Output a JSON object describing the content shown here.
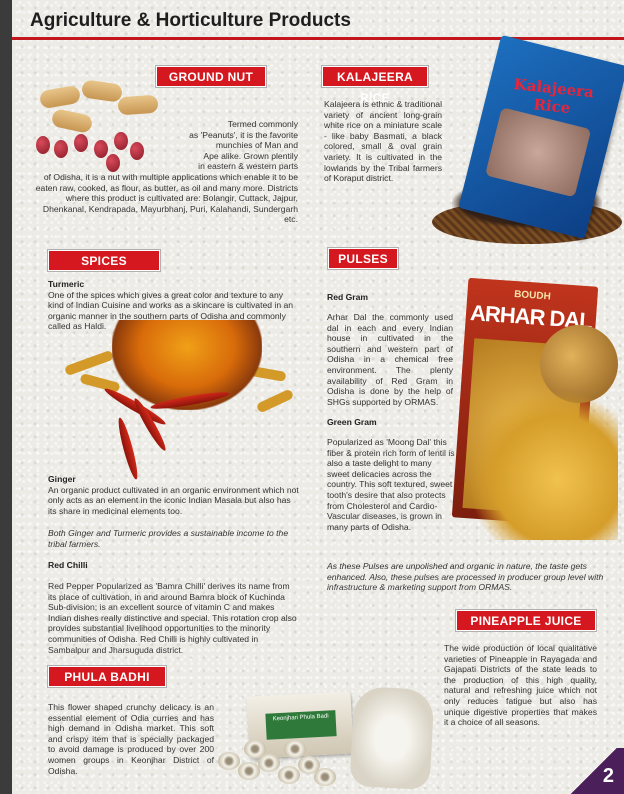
{
  "page": {
    "title": "Agriculture & Horticulture Products",
    "number": "2"
  },
  "groundnut": {
    "heading": "GROUND NUT",
    "text_right": [
      "Termed commonly",
      "as 'Peanuts', it is the favorite",
      "munchies of Man and",
      "Ape alike. Grown plentily",
      "in eastern & western parts"
    ],
    "text_main": "of Odisha, it is a nut with multiple applications which enable it to be eaten raw, cooked, as flour, as butter, as oil and many more. Districts where this product is cultivated are: Bolangir, Cuttack, Jajpur, Dhenkanal, Kendrapada, Mayurbhanj, Puri, Kalahandi, Sundergarh etc."
  },
  "kalajeera": {
    "heading": "KALAJEERA RICE",
    "text": "Kalajeera is ethnic & traditional variety of ancient long-grain white rice on a miniature scale - like baby Basmati,  a black colored, small & oval grain variety. It is cultivated in the lowlands by the Tribal farmers of Koraput district.",
    "bag_label": "Kalajeera Rice"
  },
  "spices": {
    "heading": "SPICES",
    "turmeric_title": "Turmeric",
    "turmeric_text": "One of the spices which gives a great color and texture to any kind of Indian Cuisine and works as a skincare is cultivated in an organic manner in the southern parts of Odisha and commonly called as Haldi.",
    "ginger_title": "Ginger",
    "ginger_text": "An organic product cultivated in an organic environment which not only acts as an element in the iconic Indian Masala but also has its share in medicinal elements too.",
    "note": "Both Ginger and Turmeric provides a sustainable income to the tribal farmers.",
    "chilli_title": "Red Chilli",
    "chilli_text": "Red Pepper Popularized as 'Bamra Chilli' derives its name from its place of cultivation, in and around Bamra block of Kuchinda Sub-division; is an excellent source of vitamin C and makes Indian dishes really distinctive and special. This rotation crop also provides substantial livelihood opportunities to the minority communities of Odisha. Red Chilli is highly cultivated in Sambalpur and Jharsuguda district."
  },
  "pulses": {
    "heading": "PULSES",
    "redgram_title": "Red Gram",
    "redgram_text": "Arhar Dal the commonly used dal in each and every Indian house in cultivated in the southern and western part of Odisha in a chemical free environment. The plenty availability of Red Gram in Odisha is done by the help of SHGs supported by ORMAS.",
    "greengram_title": "Green Gram",
    "greengram_text": "Popularized as 'Moong Dal' this fiber & protein rich form of lentil is also a taste delight to many sweet delicacies across the country. This soft textured, sweet tooth's desire that also protects from Cholesterol and Cardio-Vascular diseases, is grown in many parts of Odisha.",
    "note": "As these Pulses are unpolished and organic in nature, the taste gets enhanced. Also, these pulses are processed in producer group level with infrastructure &  marketing support from ORMAS.",
    "bag_top": "BOUDH",
    "bag_name": "ARHAR DAL"
  },
  "pineapple": {
    "heading": "PINEAPPLE JUICE",
    "text": "The wide production of local qualitative varieties of Pineapple in Rayagada and Gajapati Districts of the state leads to the production of this high quality, natural and refreshing juice which not only reduces fatigue but also has unique digestive properties that makes it a choice of all seasons."
  },
  "phulabadhi": {
    "heading": "PHULA BADHI",
    "text": "This flower shaped crunchy delicacy is an essential element of Odia curries and has high demand in Odisha market. This soft and crispy item that is specially packaged to avoid damage is produced by over 200 women groups in Keonjhar District of Odisha.",
    "box_label": "Keonjhari Phula Badi"
  },
  "colors": {
    "accent": "#d5181f",
    "sidebar": "#3b3b3b",
    "corner": "#4a1f5a"
  }
}
